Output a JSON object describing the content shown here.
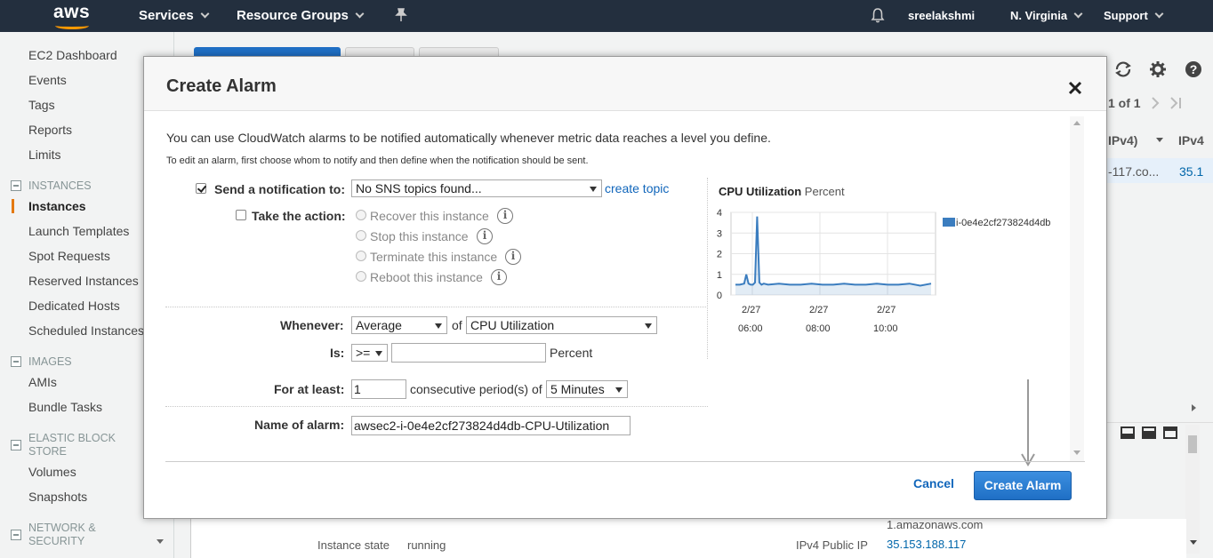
{
  "topnav": {
    "logo": "aws",
    "services": "Services",
    "resource_groups": "Resource Groups",
    "user": "sreelakshmi",
    "region": "N. Virginia",
    "support": "Support"
  },
  "sidebar": {
    "items": [
      {
        "label": "EC2 Dashboard"
      },
      {
        "label": "Events"
      },
      {
        "label": "Tags"
      },
      {
        "label": "Reports"
      },
      {
        "label": "Limits"
      }
    ],
    "instances_section": "INSTANCES",
    "instances_items": [
      {
        "label": "Instances"
      },
      {
        "label": "Launch Templates"
      },
      {
        "label": "Spot Requests"
      },
      {
        "label": "Reserved Instances"
      },
      {
        "label": "Dedicated Hosts"
      },
      {
        "label": "Scheduled Instances"
      }
    ],
    "images_section": "IMAGES",
    "images_items": [
      {
        "label": "AMIs"
      },
      {
        "label": "Bundle Tasks"
      }
    ],
    "ebs_section_line1": "ELASTIC BLOCK",
    "ebs_section_line2": "STORE",
    "ebs_items": [
      {
        "label": "Volumes"
      },
      {
        "label": "Snapshots"
      }
    ],
    "network_section_line1": "NETWORK &",
    "network_section_line2": "SECURITY"
  },
  "background": {
    "pager": "1 of 1",
    "col_ipv4_partial": "IPv4)",
    "col_ipv4": "IPv4",
    "row_dns_partial": "-117.co...",
    "row_ip_partial": "35.1",
    "dns_fragment": "1.amazonaws.com",
    "instance_state_label": "Instance state",
    "instance_state_value": "running",
    "public_ip_label": "IPv4 Public IP",
    "public_ip_value": "35.153.188.117"
  },
  "modal": {
    "title": "Create Alarm",
    "intro": "You can use CloudWatch alarms to be notified automatically whenever metric data reaches a level you define.",
    "hint": "To edit an alarm, first choose whom to notify and then define when the notification should be sent.",
    "send_notification_label": "Send a notification to:",
    "sns_select": "No SNS topics found...",
    "create_topic": "create topic",
    "take_action_label": "Take the action:",
    "actions": [
      {
        "label": "Recover this instance"
      },
      {
        "label": "Stop this instance"
      },
      {
        "label": "Terminate this instance"
      },
      {
        "label": "Reboot this instance"
      }
    ],
    "whenever_label": "Whenever:",
    "statistic": "Average",
    "of_text": "of",
    "metric": "CPU Utilization",
    "is_label": "Is:",
    "operator": ">=",
    "threshold_value": "",
    "threshold_unit": "Percent",
    "for_at_least_label": "For at least:",
    "periods": "1",
    "consecutive_text": "consecutive period(s) of",
    "period_length": "5 Minutes",
    "name_label": "Name of alarm:",
    "alarm_name": "awsec2-i-0e4e2cf273824d4db-CPU-Utilization",
    "cancel": "Cancel",
    "create": "Create Alarm"
  },
  "chart_data": {
    "type": "line",
    "title": "CPU Utilization",
    "unit": "Percent",
    "ylim": [
      0,
      4
    ],
    "yticks": [
      "4",
      "3",
      "2",
      "1",
      "0"
    ],
    "xticks": [
      {
        "line1": "2/27",
        "line2": "06:00"
      },
      {
        "line1": "2/27",
        "line2": "08:00"
      },
      {
        "line1": "2/27",
        "line2": "10:00"
      }
    ],
    "series": [
      {
        "name": "i-0e4e2cf273824d4db",
        "color": "#3b7dbf",
        "x": [
          0,
          0.2,
          0.4,
          0.5,
          0.6,
          0.7,
          0.8,
          0.9,
          1.0,
          1.1,
          1.2,
          1.3,
          1.5,
          2.0,
          2.5,
          3.0,
          3.5,
          4.0,
          4.5,
          5.0,
          5.5,
          6.0,
          6.5,
          7.0,
          7.5,
          8.0,
          8.5,
          9.0
        ],
        "values": [
          0.5,
          0.5,
          0.55,
          1.0,
          0.55,
          0.5,
          0.5,
          0.6,
          3.8,
          0.6,
          0.5,
          0.55,
          0.5,
          0.55,
          0.5,
          0.5,
          0.55,
          0.5,
          0.5,
          0.55,
          0.5,
          0.5,
          0.55,
          0.5,
          0.5,
          0.55,
          0.45,
          0.55
        ]
      }
    ],
    "grid": true,
    "legend": "right"
  },
  "colors": {
    "nav_bg": "#232f3e",
    "accent": "#e47911",
    "primary_button": "#1f6fc5",
    "link": "#1166bb"
  }
}
